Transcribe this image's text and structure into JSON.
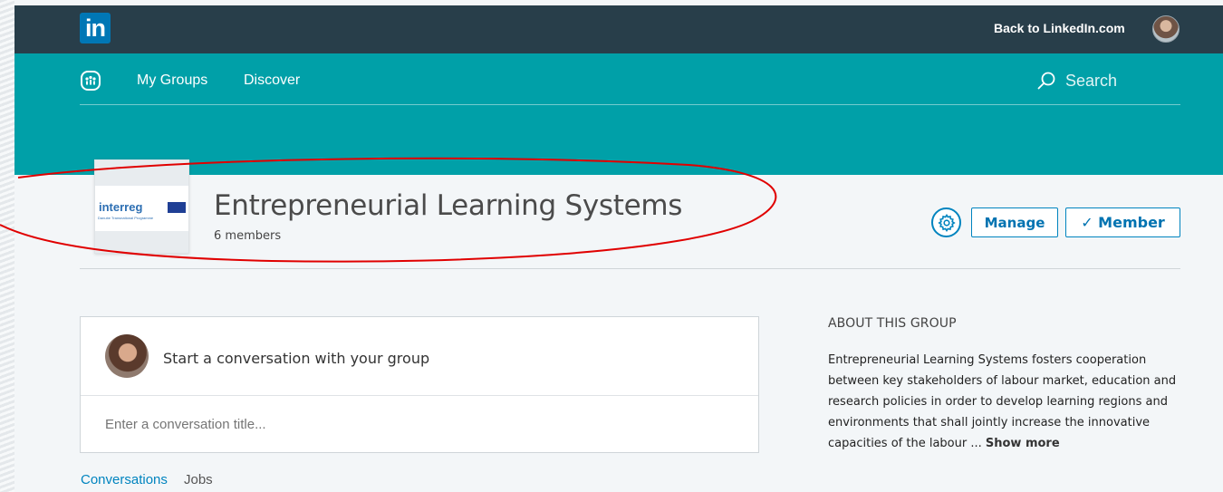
{
  "topbar": {
    "logo_text": "in",
    "back_link": "Back to LinkedIn.com"
  },
  "groups_nav": {
    "my_groups": "My Groups",
    "discover": "Discover",
    "search_placeholder": "Search"
  },
  "group": {
    "title": "Entrepreneurial Learning Systems",
    "members": "6 members",
    "logo_word": "interreg",
    "logo_sub": "Danube Transnational Programme",
    "manage_label": "Manage",
    "member_label": "✓ Member"
  },
  "composer": {
    "prompt": "Start a conversation with your group",
    "title_placeholder": "Enter a conversation title..."
  },
  "tabs": [
    {
      "label": "Conversations"
    },
    {
      "label": "Jobs"
    }
  ],
  "about": {
    "heading": "ABOUT THIS GROUP",
    "text": "Entrepreneurial Learning Systems fosters cooperation between key stakeholders of labour market, education and research policies in order to develop learning regions and environments that shall jointly increase the innovative capacities of the labour ... ",
    "show_more": "Show more"
  },
  "colors": {
    "topbar": "#283e4a",
    "groupsbar": "#00a0a8",
    "accent": "#0084bf",
    "annotation": "#e00000"
  },
  "icons": [
    "linkedin-logo",
    "groups-icon",
    "search-icon",
    "gear-icon",
    "check-icon"
  ]
}
